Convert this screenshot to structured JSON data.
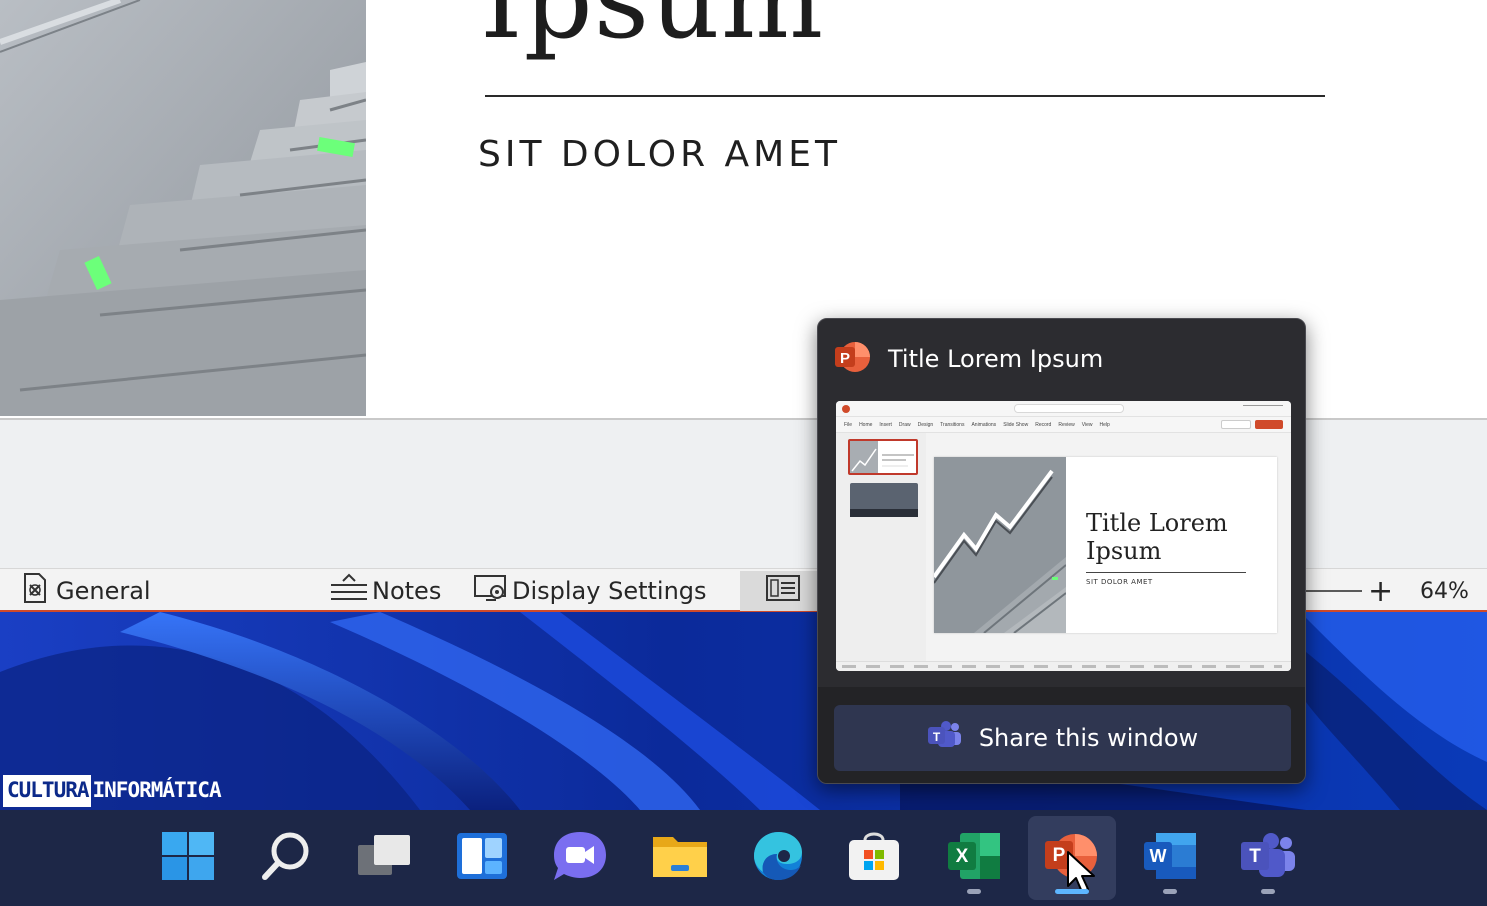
{
  "slide": {
    "title": "Ipsum",
    "subtitle": "SIT DOLOR AMET"
  },
  "status_bar": {
    "general_label": "General",
    "notes_label": "Notes",
    "display_settings_label": "Display Settings",
    "zoom_plus": "+",
    "zoom_level": "64%"
  },
  "watermark": {
    "left": "CULTURA",
    "right": "INFORMÁTICA"
  },
  "preview": {
    "window_title": "Title Lorem Ipsum",
    "share_label": "Share this window",
    "thumbnail": {
      "slide_title_line1": "Title Lorem",
      "slide_title_line2": "Ipsum",
      "slide_subtitle": "SIT DOLOR AMET",
      "menu": [
        "File",
        "Home",
        "Insert",
        "Draw",
        "Design",
        "Transitions",
        "Animations",
        "Slide Show",
        "Record",
        "Review",
        "View",
        "Help"
      ]
    }
  },
  "taskbar": {
    "items": [
      {
        "name": "start",
        "icon": "windows-logo-icon"
      },
      {
        "name": "search",
        "icon": "search-icon"
      },
      {
        "name": "task-view",
        "icon": "task-view-icon"
      },
      {
        "name": "widgets",
        "icon": "widgets-icon"
      },
      {
        "name": "chat",
        "icon": "chat-icon"
      },
      {
        "name": "file-explorer",
        "icon": "folder-icon"
      },
      {
        "name": "edge",
        "icon": "edge-icon"
      },
      {
        "name": "store",
        "icon": "store-icon"
      },
      {
        "name": "excel",
        "icon": "excel-icon",
        "letter": "X"
      },
      {
        "name": "powerpoint",
        "icon": "powerpoint-icon",
        "letter": "P"
      },
      {
        "name": "word",
        "icon": "word-icon",
        "letter": "W"
      },
      {
        "name": "teams",
        "icon": "teams-icon",
        "letter": "T"
      }
    ]
  },
  "colors": {
    "accent": "#d04a2a",
    "taskbar": "#1d2747",
    "preview_bg": "#2c2c30",
    "active_indicator": "#5db6ff"
  }
}
